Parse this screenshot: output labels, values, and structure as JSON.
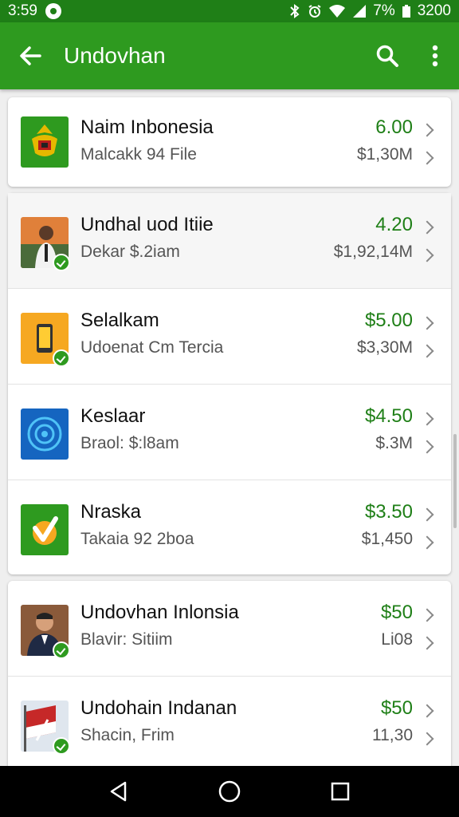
{
  "status_bar": {
    "time": "3:59",
    "battery_text": "7%",
    "extra_text": "3200",
    "icons": [
      "notification-dot-icon",
      "bluetooth-icon",
      "alarm-icon",
      "wifi-icon",
      "signal-icon",
      "battery-icon"
    ]
  },
  "app_bar": {
    "title": "Undovhan",
    "back_icon": "arrow-back-icon",
    "search_icon": "search-icon",
    "menu_icon": "more-vert-icon",
    "color": "#2e9a1f"
  },
  "items": [
    {
      "name": "Naim Inbonesia",
      "subtitle": "Malcakk 94 File",
      "price": "6.00",
      "value": "$1,30M",
      "thumb": "emblem-icon"
    },
    {
      "name": "Undhal uod Itiie",
      "subtitle": "Dekar $.2iam",
      "price": "4.20",
      "value": "$1,92,14M",
      "thumb": "person-photo"
    },
    {
      "name": "Selalkam",
      "subtitle": "Udoenat Cm Tercia",
      "price": "$5.00",
      "value": "$3,30M",
      "thumb": "phone-icon"
    },
    {
      "name": "Keslaar",
      "subtitle": "Braol: $:l8am",
      "price": "$4.50",
      "value": "$.3M",
      "thumb": "radar-icon"
    },
    {
      "name": "Nraska",
      "subtitle": "Takaia 92 2boa",
      "price": "$3.50",
      "value": "$1,450",
      "thumb": "shield-check-icon"
    },
    {
      "name": "Undovhan Inlonsia",
      "subtitle": "Blavir: Sitiim",
      "price": "$50",
      "value": "Li08",
      "thumb": "person-photo"
    },
    {
      "name": "Undohain Indanan",
      "subtitle": "Shacin, Frim",
      "price": "$50",
      "value": "11,30",
      "thumb": "flag-photo"
    }
  ],
  "nav_bar": {
    "back": "nav-back-icon",
    "home": "nav-home-icon",
    "recents": "nav-recents-icon"
  },
  "colors": {
    "accent": "#2e9a1f",
    "status_bar": "#1f7f17",
    "price": "#1f7f17"
  }
}
